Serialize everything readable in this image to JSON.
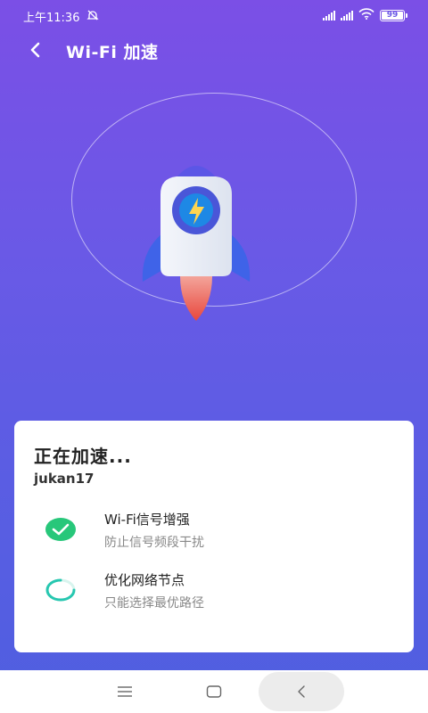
{
  "status_bar": {
    "time": "上午11:36",
    "battery": "99",
    "icons": [
      "dnd-off-icon",
      "signal-icon",
      "signal-icon",
      "wifi-icon",
      "battery-icon"
    ]
  },
  "header": {
    "title": "Wi-Fi 加速",
    "back_icon": "back-arrow-icon"
  },
  "illustration": {
    "icon": "rocket-icon",
    "accent": "#1e88e5",
    "bolt_color": "#ffd54f",
    "flame_color": "#f0544f"
  },
  "card": {
    "title": "正在加速...",
    "network": "jukan17",
    "tasks": [
      {
        "title": "Wi-Fi信号增强",
        "subtitle": "防止信号频段干扰",
        "status": "done",
        "icon": "check-icon",
        "color": "#27c77a"
      },
      {
        "title": "优化网络节点",
        "subtitle": "只能选择最优路径",
        "status": "in-progress",
        "icon": "spinner-icon",
        "color": "#27c7b0"
      }
    ]
  },
  "nav_bar": {
    "icons": [
      "menu-icon",
      "home-icon",
      "back-icon"
    ]
  }
}
